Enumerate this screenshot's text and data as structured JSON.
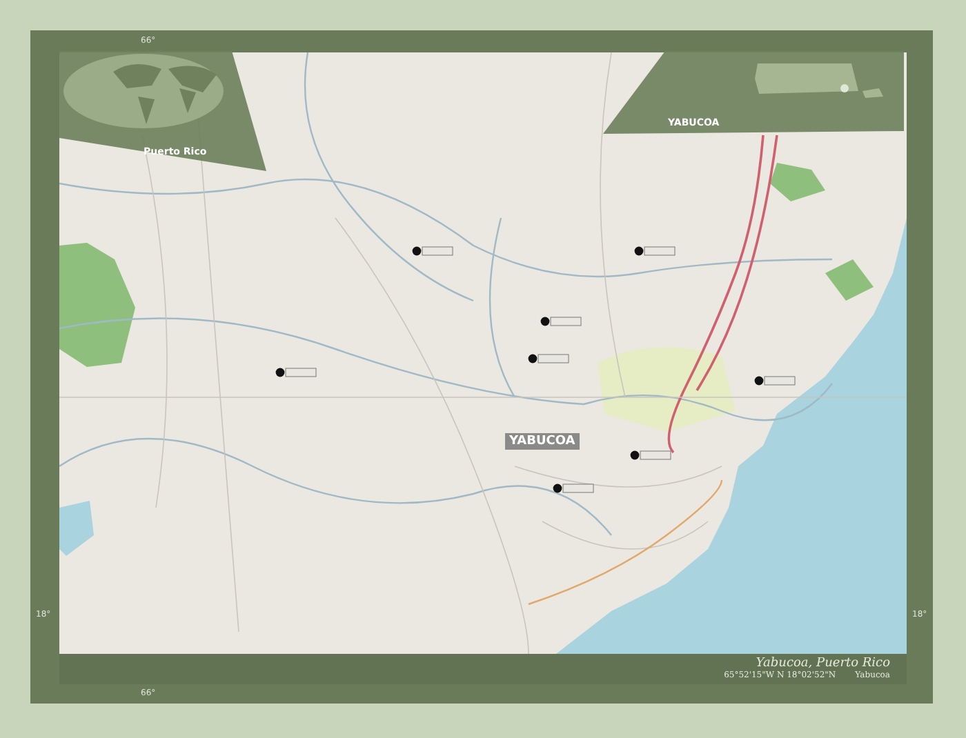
{
  "map": {
    "main_label": "YABUCOA",
    "ticks": [
      {
        "label": "66°",
        "kind": "top"
      },
      {
        "label": "66°",
        "kind": "bottom"
      },
      {
        "label": "18°",
        "kind": "left"
      },
      {
        "label": "18°",
        "kind": "right"
      }
    ]
  },
  "world_inset": {
    "label": "Puerto Rico"
  },
  "locator_inset": {
    "label": "YABUCOA"
  },
  "caption": {
    "title": "Yabucoa, Puerto Rico",
    "coordinates": "65°52'15\"W N 18°02'52\"N",
    "source": "Yabucoa"
  }
}
